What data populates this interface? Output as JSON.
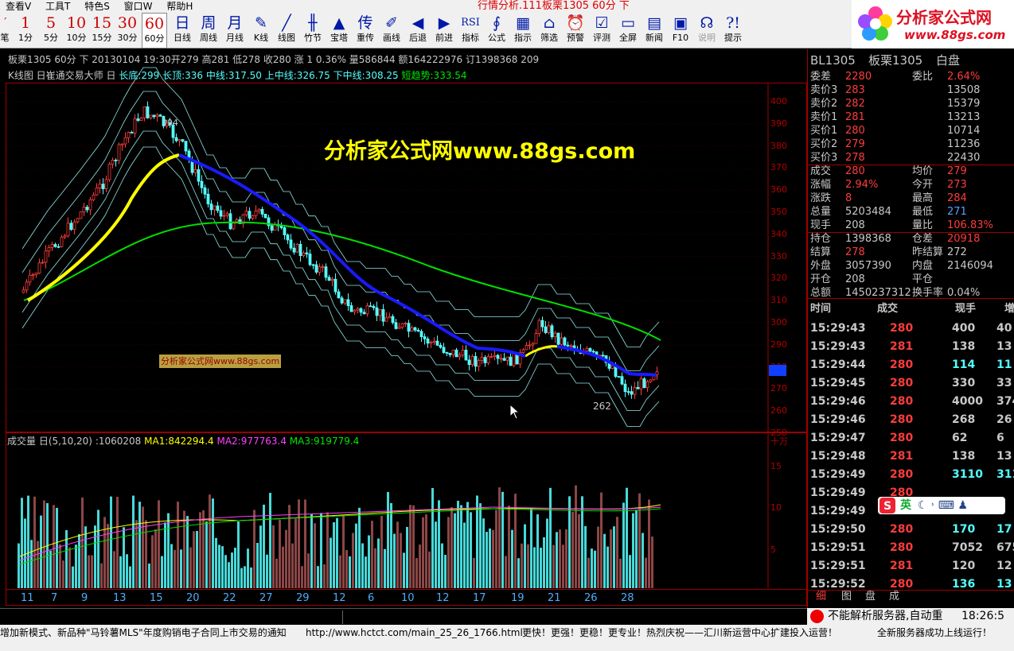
{
  "menu": {
    "items": [
      "查看V",
      "工具T",
      "特色S",
      "窗口W",
      "帮助H"
    ],
    "title": "行情分析.111板栗1305 60分 下"
  },
  "toolbar": [
    {
      "icon": "1",
      "label": "1分"
    },
    {
      "icon": "5",
      "label": "5分"
    },
    {
      "icon": "10",
      "label": "10分"
    },
    {
      "icon": "15",
      "label": "15分"
    },
    {
      "icon": "30",
      "label": "30分"
    },
    {
      "icon": "60",
      "label": "60分"
    },
    {
      "icon": "日",
      "label": "日线"
    },
    {
      "icon": "周",
      "label": "周线"
    },
    {
      "icon": "月",
      "label": "月线"
    },
    {
      "icon": "✎",
      "label": "K线"
    },
    {
      "icon": "╱",
      "label": "线图"
    },
    {
      "icon": "╫",
      "label": "竹节"
    },
    {
      "icon": "▲",
      "label": "宝塔"
    },
    {
      "icon": "传",
      "label": "重传"
    },
    {
      "icon": "✐",
      "label": "画线"
    },
    {
      "icon": "◀",
      "label": "后退"
    },
    {
      "icon": "▶",
      "label": "前进"
    },
    {
      "icon": "RSI",
      "label": "指标"
    },
    {
      "icon": "∮",
      "label": "公式"
    },
    {
      "icon": "▦",
      "label": "指示"
    },
    {
      "icon": "⌂",
      "label": "筛选"
    },
    {
      "icon": "⏰",
      "label": "预警"
    },
    {
      "icon": "☑",
      "label": "评测"
    },
    {
      "icon": "▭",
      "label": "全屏"
    },
    {
      "icon": "▤",
      "label": "新闻"
    },
    {
      "icon": "▣",
      "label": "F10"
    },
    {
      "icon": "☊",
      "label": "说明"
    },
    {
      "icon": "?!",
      "label": "提示"
    }
  ],
  "toolbar_left_label": "笔",
  "logo": {
    "name": "分析家公式网",
    "url": "www.88gs.com"
  },
  "header": {
    "line1": "板栗1305 60分 下 20130104 19:30开279 高281 低278 收280 涨 1 0.36% 量586844 额164222976 订1398368 209",
    "line2_prefix": "K线图 日崔通交易大师 日",
    "l_changdi": "长底:299",
    "l_changding": "长顶:336",
    "l_zhong": "中线:317.50",
    "l_shangzhong": "上中线:326.75",
    "l_xiazhong": "下中线:308.25",
    "l_duan": "短趋势:333.54"
  },
  "watermark": "分析家公式网www.88gs.com",
  "small_watermark": "分析家公式网www.88gs.com",
  "annot_high": "394",
  "annot_low": "262",
  "price_axis": [
    "400",
    "390",
    "380",
    "370",
    "360",
    "350",
    "340",
    "330",
    "320",
    "310",
    "300",
    "290",
    "280",
    "270",
    "260",
    "250"
  ],
  "vol_header": {
    "name": "成交量 日(5,10,20)",
    "value": ":1060208",
    "ma1": "MA1:842294.4",
    "ma2": "MA2:977763.4",
    "ma3": "MA3:919779.4",
    "unit": "十万"
  },
  "vol_axis": [
    "15",
    "10",
    "5"
  ],
  "date_axis": [
    "11",
    "7",
    "9",
    "13",
    "15",
    "20",
    "22",
    "27",
    "29",
    "12",
    "6",
    "10",
    "12",
    "17",
    "19",
    "21",
    "26",
    "28"
  ],
  "quote": {
    "title": "BL1305",
    "name": "板栗1305",
    "session": "白盘",
    "rows": [
      [
        "委差",
        "2280",
        "委比",
        "2.64%"
      ],
      [
        "卖价3",
        "283",
        "",
        "13508"
      ],
      [
        "卖价2",
        "282",
        "",
        "15379"
      ],
      [
        "卖价1",
        "281",
        "",
        "13213"
      ],
      [
        "买价1",
        "280",
        "",
        "10714"
      ],
      [
        "买价2",
        "279",
        "",
        "11236"
      ],
      [
        "买价3",
        "278",
        "",
        "22430"
      ],
      [
        "成交",
        "280",
        "均价",
        "279"
      ],
      [
        "涨幅",
        "2.94%",
        "今开",
        "273"
      ],
      [
        "涨跌",
        "8",
        "最高",
        "284"
      ],
      [
        "总量",
        "5203484",
        "最低",
        "271"
      ],
      [
        "现手",
        "208",
        "量比",
        "106.83%"
      ],
      [
        "持仓",
        "1398368",
        "仓差",
        "20918"
      ],
      [
        "结算",
        "278",
        "昨结算",
        "272"
      ],
      [
        "外盘",
        "3057390",
        "内盘",
        "2146094"
      ],
      [
        "开仓",
        "208",
        "平仓",
        ""
      ],
      [
        "总额",
        "1450237312",
        "换手率",
        "0.04%"
      ]
    ]
  },
  "ticks_header": [
    "时间",
    "成交",
    "现手",
    "增"
  ],
  "ticks": [
    [
      "15:29:43",
      "280",
      "400",
      "40"
    ],
    [
      "15:29:43",
      "281",
      "138",
      "13"
    ],
    [
      "15:29:44",
      "280",
      "114",
      "11"
    ],
    [
      "15:29:45",
      "280",
      "330",
      "33"
    ],
    [
      "15:29:46",
      "280",
      "4000",
      "374"
    ],
    [
      "15:29:46",
      "280",
      "268",
      "26"
    ],
    [
      "15:29:47",
      "280",
      "62",
      "6"
    ],
    [
      "15:29:48",
      "281",
      "138",
      "13"
    ],
    [
      "15:29:49",
      "280",
      "3110",
      "311"
    ],
    [
      "15:29:49",
      "280",
      "",
      ""
    ],
    [
      "15:29:49",
      "280",
      "",
      ""
    ],
    [
      "15:29:50",
      "280",
      "170",
      "17"
    ],
    [
      "15:29:51",
      "280",
      "7052",
      "675"
    ],
    [
      "15:29:51",
      "281",
      "120",
      "12"
    ],
    [
      "15:29:52",
      "280",
      "136",
      "13"
    ]
  ],
  "tabs": [
    "细",
    "图",
    "盘",
    "成"
  ],
  "ime": "英",
  "status": {
    "ticker1": "增加新模式、新品种\"马铃薯MLS\"年度购销电子合同上市交易的通知",
    "ticker2": "http://www.hctct.com/main_25_26_1766.html",
    "ticker3": "更快！更强！更稳！更专业！热烈庆祝——汇川新运营中心扩建投入运营！",
    "ticker4": "全新服务器成功上线运行！",
    "server": "不能解析服务器,自动重",
    "clock": "18:26:5"
  },
  "colors": {
    "up": "#ff3c3c",
    "down": "#54ffff",
    "yellow": "#ffff00",
    "blue": "#0000ff",
    "green": "#00dd00",
    "frame": "#a00000"
  },
  "chart_data": {
    "type": "line",
    "title": "板栗1305 60分",
    "ylim": [
      250,
      400
    ],
    "series": [
      {
        "name": "长底",
        "values": [
          299
        ]
      },
      {
        "name": "长顶",
        "values": [
          336
        ]
      },
      {
        "name": "中线",
        "values": [
          317.5
        ]
      },
      {
        "name": "上中线",
        "values": [
          326.75
        ]
      },
      {
        "name": "下中线",
        "values": [
          308.25
        ]
      },
      {
        "name": "短趋势",
        "values": [
          333.54
        ]
      }
    ]
  }
}
